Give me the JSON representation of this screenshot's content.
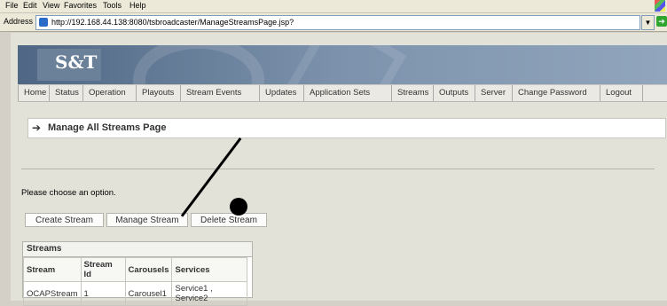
{
  "menu": [
    "File",
    "Edit",
    "View",
    "Favorites",
    "Tools",
    "Help"
  ],
  "address": {
    "label": "Address",
    "url": "http://192.168.44.138:8080/tsbroadcaster/ManageStreamsPage.jsp?"
  },
  "logo": "S&T",
  "nav": [
    "Home",
    "Status",
    "Operation",
    "Playouts",
    "Stream Events",
    "Updates",
    "Application Sets",
    "Streams",
    "Outputs",
    "Server",
    "Change Password",
    "Logout"
  ],
  "page_title": "Manage All Streams Page",
  "prompt": "Please choose an option.",
  "buttons": [
    "Create Stream",
    "Manage Stream",
    "Delete Stream"
  ],
  "streams_table": {
    "title": "Streams",
    "columns": [
      "Stream",
      "Stream Id",
      "Carousels",
      "Services"
    ],
    "rows": [
      [
        "OCAPStream",
        "1",
        "Carousel1",
        "Service1 , Service2"
      ]
    ]
  }
}
